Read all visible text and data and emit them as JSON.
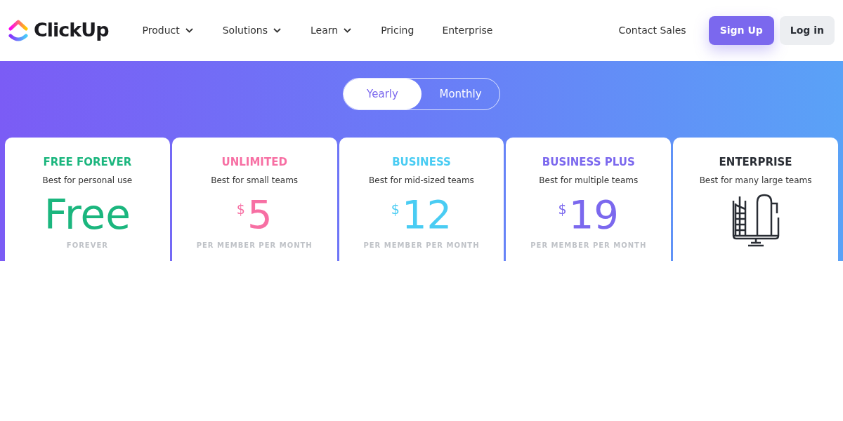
{
  "header": {
    "logo_text": "ClickUp",
    "nav": [
      {
        "label": "Product",
        "has_menu": true
      },
      {
        "label": "Solutions",
        "has_menu": true
      },
      {
        "label": "Learn",
        "has_menu": true
      },
      {
        "label": "Pricing",
        "has_menu": false
      },
      {
        "label": "Enterprise",
        "has_menu": false
      }
    ],
    "contact": "Contact Sales",
    "signup": "Sign Up",
    "login": "Log in"
  },
  "billing_toggle": [
    {
      "label": "Yearly",
      "selected": true
    },
    {
      "label": "Monthly",
      "selected": false
    }
  ],
  "plans": [
    {
      "kind": "text",
      "name": "FREE FOREVER",
      "color": "#1bb67e",
      "tagline": "Best for personal use",
      "price": "Free",
      "period": "FOREVER"
    },
    {
      "kind": "amount",
      "name": "UNLIMITED",
      "color": "#f76fa3",
      "tagline": "Best for small teams",
      "currency": "$",
      "price": "5",
      "period": "PER MEMBER PER MONTH"
    },
    {
      "kind": "amount",
      "name": "BUSINESS",
      "color": "#49ccf3",
      "tagline": "Best for mid-sized teams",
      "currency": "$",
      "price": "12",
      "period": "PER MEMBER PER MONTH"
    },
    {
      "kind": "amount",
      "name": "BUSINESS PLUS",
      "color": "#7b68ee",
      "tagline": "Best for multiple teams",
      "currency": "$",
      "price": "19",
      "period": "PER MEMBER PER MONTH"
    },
    {
      "kind": "icon",
      "name": "ENTERPRISE",
      "color": "#292d34",
      "tagline": "Best for many large teams"
    }
  ]
}
